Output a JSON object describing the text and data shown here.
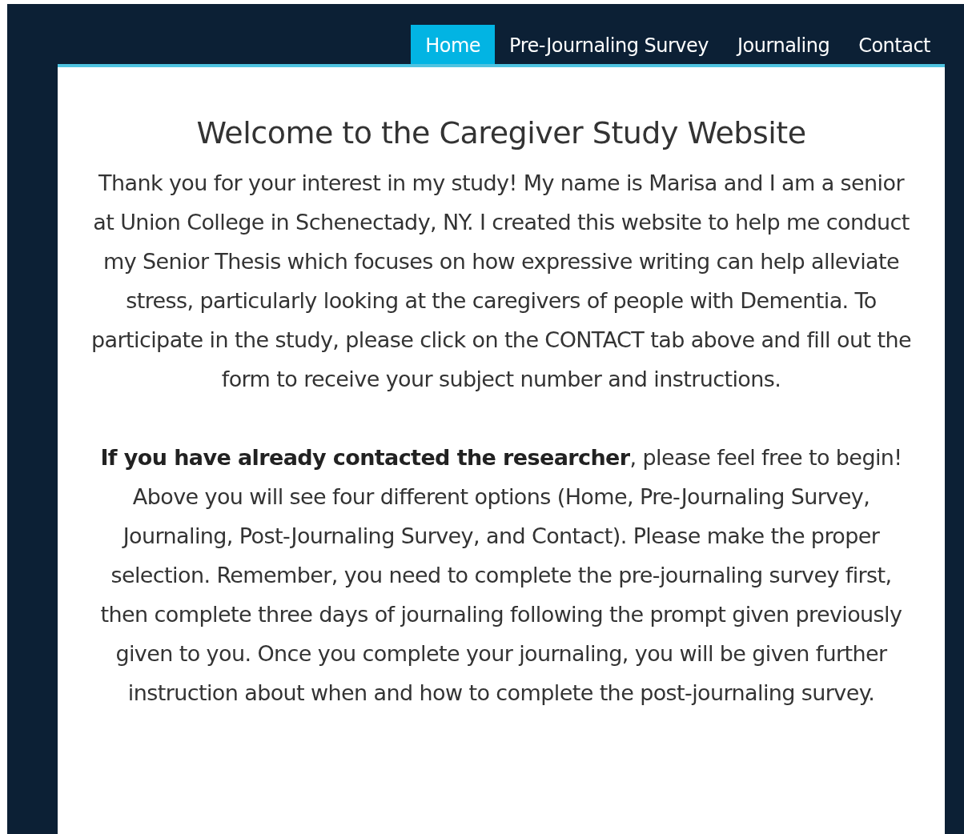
{
  "nav": {
    "tabs": [
      {
        "label": "Home",
        "selected": true
      },
      {
        "label": "Pre-Journaling Survey",
        "selected": false
      },
      {
        "label": "Journaling",
        "selected": false
      },
      {
        "label": "Contact",
        "selected": false
      }
    ]
  },
  "content": {
    "title": "Welcome to the Caregiver Study Website",
    "paragraphs": [
      "Thank you for your interest in my study! My name is Marisa and I am a senior at Union College in Schenectady, NY. I created this website to help me conduct my Senior Thesis which focuses on how expressive writing can help alleviate stress, particularly looking at the caregivers of people with Dementia. To participate in the study, please click on the CONTACT tab above and fill out the form to receive your subject number and instructions.",
      "**If you have already contacted the researcher**, please feel free to begin! Above you will see four different options (Home, Pre-Journaling Survey, Journaling, Post-Journaling Survey, and Contact). Please make the proper selection. Remember, you need to complete the pre-journaling survey first, then complete three days of journaling following the prompt given previously given to you. Once you complete your journaling, you will be given further instruction about when and how to complete the post-journaling survey."
    ]
  }
}
